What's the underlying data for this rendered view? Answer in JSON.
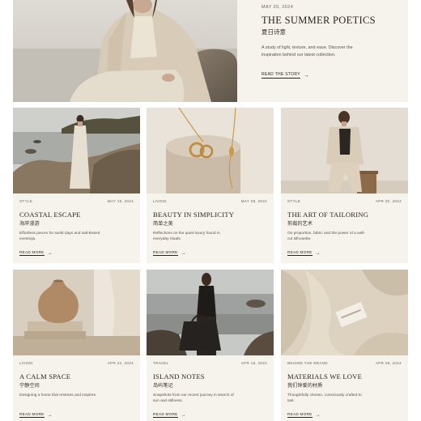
{
  "hero": {
    "date": "MAY 20, 2024",
    "title": "THE SUMMER POETICS",
    "title_cn": "夏日诗意",
    "description": "A study of light, texture, and ease. Discover the inspiration behind our latest collection.",
    "link_label": "READ THE STORY",
    "link_icon": "→"
  },
  "cards": [
    {
      "category": "STYLE",
      "date": "MAY 15, 2024",
      "title": "COASTAL ESCAPE",
      "title_cn": "海岸漫游",
      "description": "Effortless pieces for sunlit days and salt-kissed evenings.",
      "link_label": "READ MORE",
      "link_icon": "→"
    },
    {
      "category": "LIVING",
      "date": "MAY 08, 2024",
      "title": "BEAUTY IN SIMPLICITY",
      "title_cn": "简单之美",
      "description": "Reflections on the quiet luxury found in everyday rituals.",
      "link_label": "READ MORE",
      "link_icon": "→"
    },
    {
      "category": "STYLE",
      "date": "APR 30, 2024",
      "title": "THE ART OF TAILORING",
      "title_cn": "剪裁的艺术",
      "description": "On proportion, fabric and the power of a well-cut silhouette.",
      "link_label": "READ MORE",
      "link_icon": "→"
    },
    {
      "category": "LIVING",
      "date": "APR 22, 2024",
      "title": "A CALM SPACE",
      "title_cn": "宁静空间",
      "description": "Designing a home that restores and inspires.",
      "link_label": "READ MORE",
      "link_icon": "→"
    },
    {
      "category": "TRAVEL",
      "date": "APR 15, 2024",
      "title": "ISLAND NOTES",
      "title_cn": "岛屿笔记",
      "description": "Snapshots from our recent journey in search of sun and stillness.",
      "link_label": "READ MORE",
      "link_icon": "→"
    },
    {
      "category": "BEHIND THE BRAND",
      "date": "APR 08, 2024",
      "title": "MATERIALS WE LOVE",
      "title_cn": "我们钟爱的材质",
      "description": "Thoughtfully chosen, consciously crafted to last.",
      "link_label": "READ MORE",
      "link_icon": "→"
    }
  ],
  "colors": {
    "card_background": "#f6f2ec",
    "text_primary": "#2b2520",
    "text_muted": "#6d665e"
  }
}
